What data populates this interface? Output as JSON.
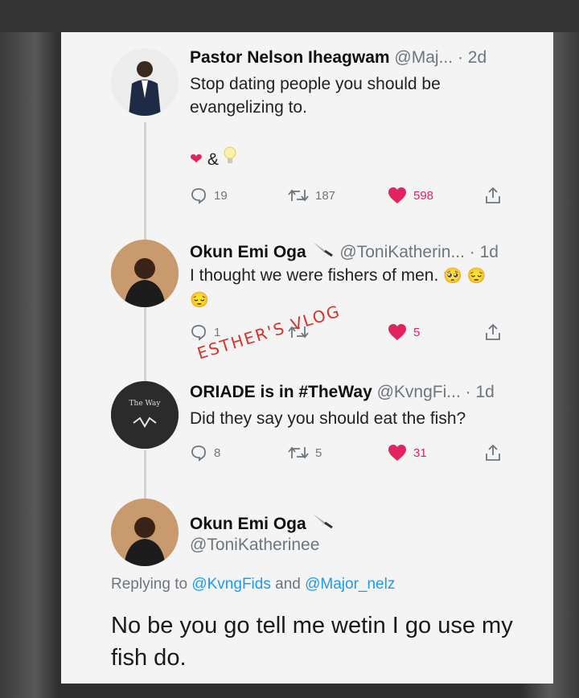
{
  "watermark": "ESTHER'S VLOG",
  "tweets": [
    {
      "name": "Pastor Nelson Iheagwam",
      "handle": "@Maj...",
      "time": "· 2d",
      "text": "Stop dating people you should be evangelizing to.",
      "reaction_line": "&",
      "replies": "19",
      "retweets": "187",
      "likes": "598"
    },
    {
      "name": "Okun Emi Oga",
      "handle": "@ToniKatherin...",
      "time": "· 1d",
      "text": "I thought we were fishers of men.",
      "replies": "1",
      "retweets": "",
      "likes": "5"
    },
    {
      "name": "ORIADE is in #TheWay",
      "handle": "@KvngFi...",
      "time": "· 1d",
      "avatar_text": "The Way",
      "text": "Did they say you should eat the fish?",
      "replies": "8",
      "retweets": "5",
      "likes": "31"
    }
  ],
  "main_tweet": {
    "name": "Okun Emi Oga",
    "handle": "@ToniKatherinee",
    "replying_prefix": "Replying to",
    "mention_1": "@KvngFids",
    "and_word": "and",
    "mention_2": "@Major_nelz",
    "text": "No be you go tell me wetin I go use my fish do."
  },
  "colors": {
    "like": "#e0245e",
    "mention": "#1d9bf0",
    "muted": "#6e767d",
    "watermark": "#d6332b"
  },
  "icons": [
    "reply-icon",
    "retweet-icon",
    "heart-icon",
    "share-icon",
    "knife-icon"
  ]
}
